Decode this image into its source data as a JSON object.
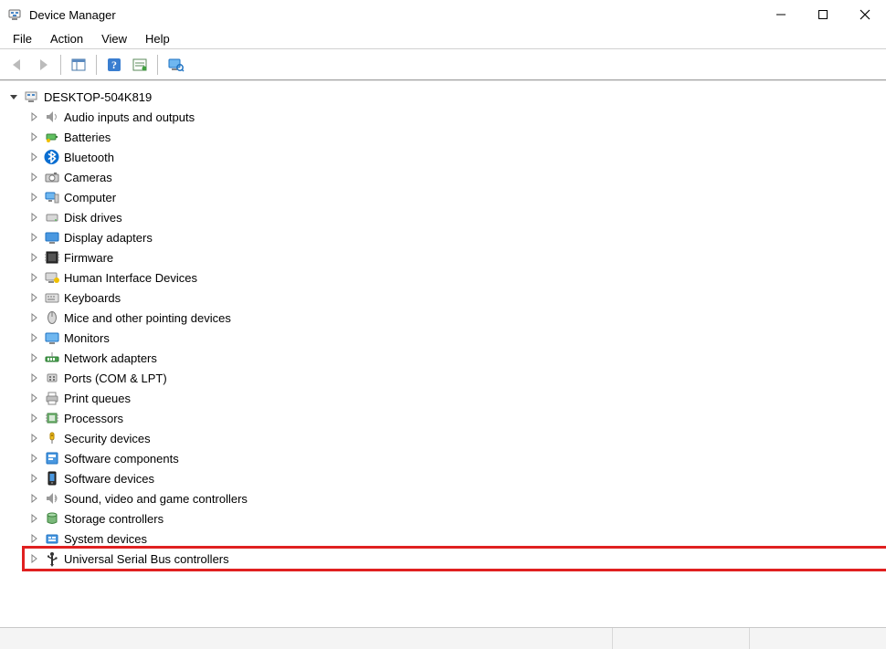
{
  "window": {
    "title": "Device Manager"
  },
  "menu": {
    "items": [
      "File",
      "Action",
      "View",
      "Help"
    ]
  },
  "toolbar": {
    "buttons": [
      {
        "name": "back-button",
        "icon": "arrow-left",
        "enabled": false
      },
      {
        "name": "forward-button",
        "icon": "arrow-right",
        "enabled": false
      },
      {
        "name": "separator"
      },
      {
        "name": "show-hide-tree-button",
        "icon": "console-tree",
        "enabled": true
      },
      {
        "name": "separator"
      },
      {
        "name": "help-button",
        "icon": "help",
        "enabled": true
      },
      {
        "name": "action-button",
        "icon": "action-list",
        "enabled": true
      },
      {
        "name": "separator"
      },
      {
        "name": "scan-hardware-button",
        "icon": "scan-monitor",
        "enabled": true
      }
    ]
  },
  "tree": {
    "root": {
      "label": "DESKTOP-504K819",
      "icon": "computer",
      "expanded": true,
      "children": [
        {
          "label": "Audio inputs and outputs",
          "icon": "audio"
        },
        {
          "label": "Batteries",
          "icon": "battery"
        },
        {
          "label": "Bluetooth",
          "icon": "bluetooth"
        },
        {
          "label": "Cameras",
          "icon": "camera"
        },
        {
          "label": "Computer",
          "icon": "pc"
        },
        {
          "label": "Disk drives",
          "icon": "disk"
        },
        {
          "label": "Display adapters",
          "icon": "display"
        },
        {
          "label": "Firmware",
          "icon": "firmware"
        },
        {
          "label": "Human Interface Devices",
          "icon": "hid"
        },
        {
          "label": "Keyboards",
          "icon": "keyboard"
        },
        {
          "label": "Mice and other pointing devices",
          "icon": "mouse"
        },
        {
          "label": "Monitors",
          "icon": "monitor"
        },
        {
          "label": "Network adapters",
          "icon": "network"
        },
        {
          "label": "Ports (COM & LPT)",
          "icon": "port"
        },
        {
          "label": "Print queues",
          "icon": "printer"
        },
        {
          "label": "Processors",
          "icon": "cpu"
        },
        {
          "label": "Security devices",
          "icon": "security"
        },
        {
          "label": "Software components",
          "icon": "swcomp"
        },
        {
          "label": "Software devices",
          "icon": "swdev"
        },
        {
          "label": "Sound, video and game controllers",
          "icon": "sound"
        },
        {
          "label": "Storage controllers",
          "icon": "storage"
        },
        {
          "label": "System devices",
          "icon": "system"
        },
        {
          "label": "Universal Serial Bus controllers",
          "icon": "usb",
          "highlighted": true
        }
      ]
    }
  }
}
